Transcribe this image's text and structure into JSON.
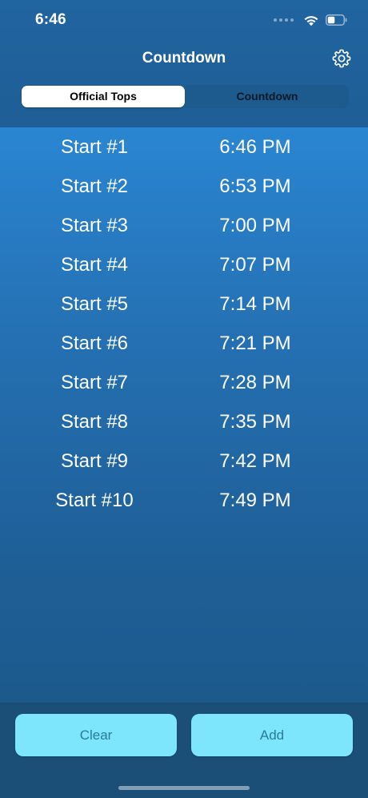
{
  "status_bar": {
    "time": "6:46",
    "icons": [
      "cellular-dots-icon",
      "wifi-icon",
      "battery-icon"
    ]
  },
  "nav": {
    "title": "Countdown",
    "settings_icon": "gear-icon"
  },
  "segments": {
    "items": [
      {
        "label": "Official Tops",
        "selected": true
      },
      {
        "label": "Countdown",
        "selected": false
      }
    ]
  },
  "starts": [
    {
      "label": "Start #1",
      "time": "6:46 PM"
    },
    {
      "label": "Start #2",
      "time": "6:53 PM"
    },
    {
      "label": "Start #3",
      "time": "7:00 PM"
    },
    {
      "label": "Start #4",
      "time": "7:07 PM"
    },
    {
      "label": "Start #5",
      "time": "7:14 PM"
    },
    {
      "label": "Start #6",
      "time": "7:21 PM"
    },
    {
      "label": "Start #7",
      "time": "7:28 PM"
    },
    {
      "label": "Start #8",
      "time": "7:35 PM"
    },
    {
      "label": "Start #9",
      "time": "7:42 PM"
    },
    {
      "label": "Start #10",
      "time": "7:49 PM"
    }
  ],
  "actions": {
    "clear_label": "Clear",
    "add_label": "Add"
  },
  "colors": {
    "accent_button": "#7de6fc",
    "button_text": "#2a7c95",
    "header_bg": "#2064a0",
    "list_gradient_top": "#2a86d2",
    "list_gradient_bottom": "#1c5a8c",
    "bottom_bar": "#1b4f78"
  }
}
